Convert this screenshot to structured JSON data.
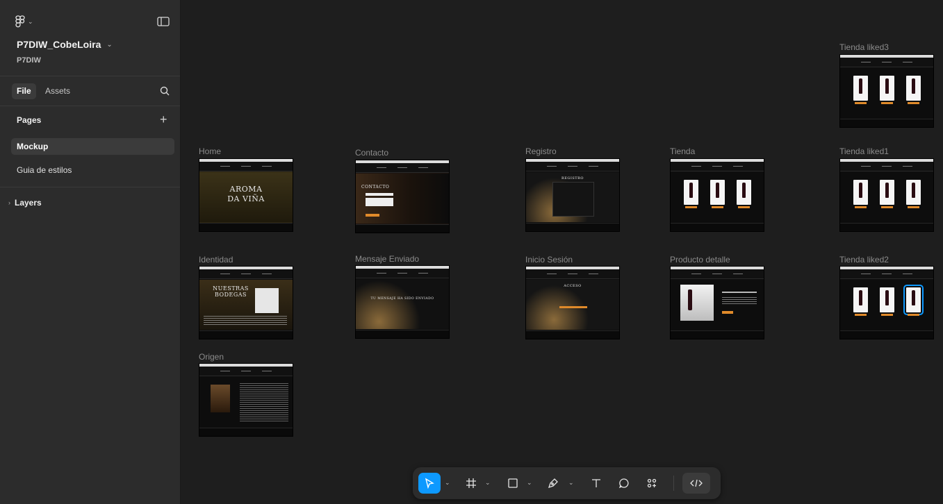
{
  "sidebar": {
    "project_name": "P7DIW_CobeLoira",
    "team_name": "P7DIW",
    "tabs": {
      "file": "File",
      "assets": "Assets"
    },
    "pages_header": "Pages",
    "pages": [
      "Mockup",
      "Guia de estilos"
    ],
    "layers_label": "Layers"
  },
  "canvas": {
    "frames": {
      "home": "Home",
      "contacto": "Contacto",
      "registro": "Registro",
      "tienda": "Tienda",
      "tienda_liked1": "Tienda liked1",
      "tienda_liked2": "Tienda liked2",
      "tienda_liked3": "Tienda liked3",
      "identidad": "Identidad",
      "mensaje_enviado": "Mensaje Enviado",
      "inicio_sesion": "Inicio Sesión",
      "producto_detalle": "Producto detalle",
      "origen": "Origen"
    },
    "thumb_text": {
      "home_line1": "AROMA",
      "home_line2": "DA VIÑA",
      "contacto": "CONTACTO",
      "registro": "REGISTRO",
      "identidad_line1": "NUESTRAS",
      "identidad_line2": "BODEGAS",
      "mensaje": "TU MENSAJE HA SIDO ENVIADO",
      "acceso": "ACCESO"
    }
  },
  "toolbar": {
    "tools": [
      "move-tool",
      "frame-tool",
      "shape-tool",
      "pen-tool",
      "text-tool",
      "comment-tool",
      "actions-tool",
      "dev-mode-toggle"
    ],
    "active_tool": "move-tool",
    "accent": "#0d99ff"
  }
}
